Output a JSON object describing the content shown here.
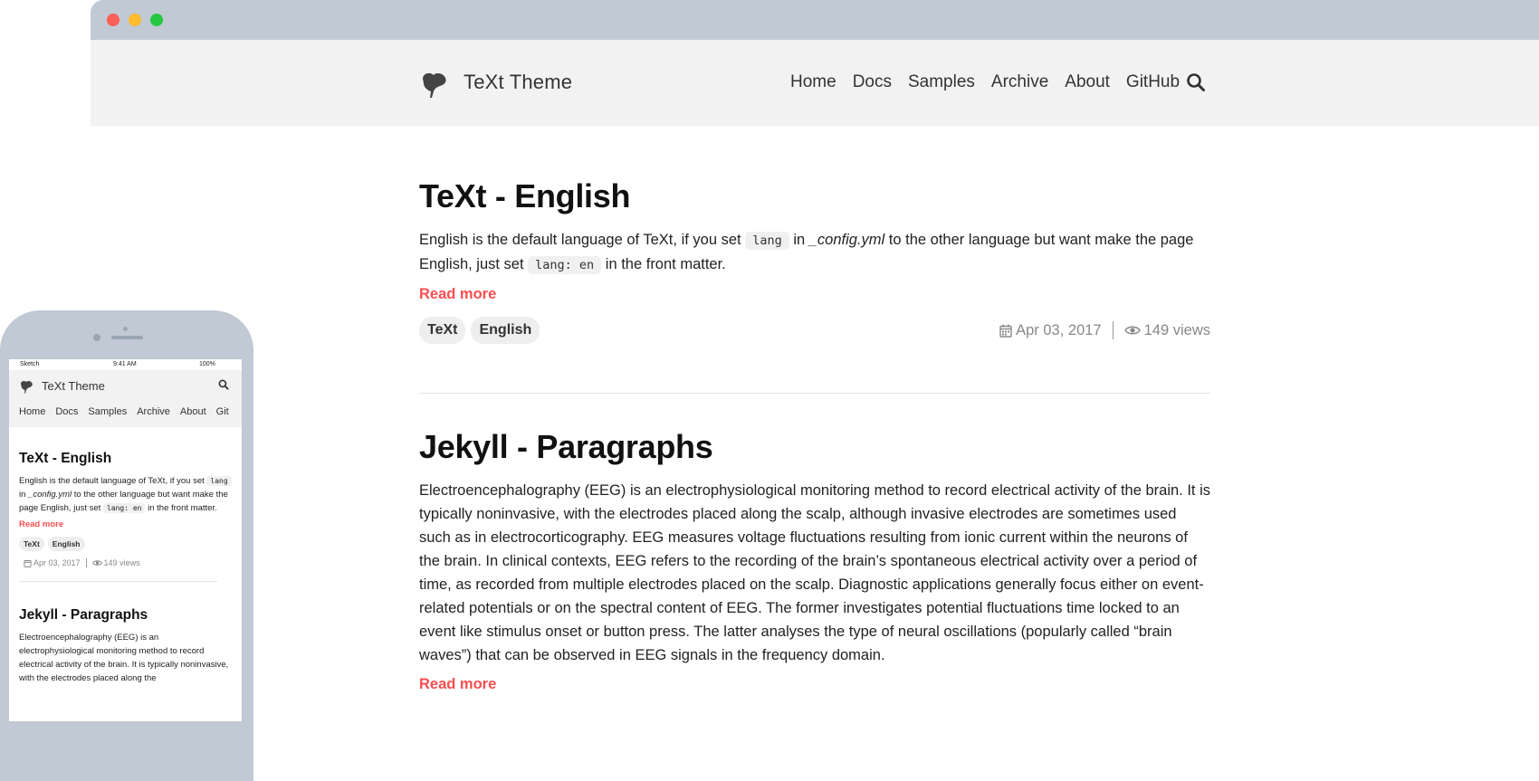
{
  "site": {
    "title": "TeXt Theme",
    "nav": [
      "Home",
      "Docs",
      "Samples",
      "Archive",
      "About",
      "GitHub"
    ]
  },
  "posts": [
    {
      "title": "TeXt - English",
      "excerpt_parts": {
        "p1": "English is the default language of TeXt, if you set",
        "code1": "lang",
        "p2": "in",
        "file": "_config.yml",
        "p3": "to the other language but want make the page English, just set",
        "code2": "lang: en",
        "p4": "in the front matter."
      },
      "read_more": "Read more",
      "tags": [
        "TeXt",
        "English"
      ],
      "date": "Apr 03, 2017",
      "views": "149 views"
    },
    {
      "title": "Jekyll - Paragraphs",
      "excerpt": "Electroencephalography (EEG) is an electrophysiological monitoring method to record electrical activity of the brain. It is typically noninvasive, with the electrodes placed along the scalp, although invasive electrodes are sometimes used such as in electrocorticography. EEG measures voltage fluctuations resulting from ionic current within the neurons of the brain. In clinical contexts, EEG refers to the recording of the brain’s spontaneous electrical activity over a period of time, as recorded from multiple electrodes placed on the scalp. Diagnostic applications generally focus either on event-related potentials or on the spectral content of EEG. The former investigates potential fluctuations time locked to an event like stimulus onset or button press. The latter analyses the type of neural oscillations (popularly called “brain waves”) that can be observed in EEG signals in the frequency domain.",
      "read_more": "Read more"
    }
  ],
  "mobile": {
    "status_carrier": "Sketch",
    "status_time": "9:41 AM",
    "status_battery": "100%",
    "title": "TeXt Theme",
    "nav": [
      "Home",
      "Docs",
      "Samples",
      "Archive",
      "About",
      "Git"
    ],
    "post1_title": "TeXt - English",
    "post1_read_more": "Read more",
    "post1_tags": [
      "TeXt",
      "English"
    ],
    "post1_date": "Apr 03, 2017",
    "post1_views": "149 views",
    "post2_title": "Jekyll - Paragraphs",
    "post2_excerpt": "Electroencephalography (EEG) is an electrophysiological monitoring method to record electrical activity of the brain. It is typically noninvasive, with the electrodes placed along the"
  },
  "colors": {
    "accent": "#fc4d50",
    "header_bg": "#f2f2f2",
    "frame": "#c0c9d4"
  }
}
